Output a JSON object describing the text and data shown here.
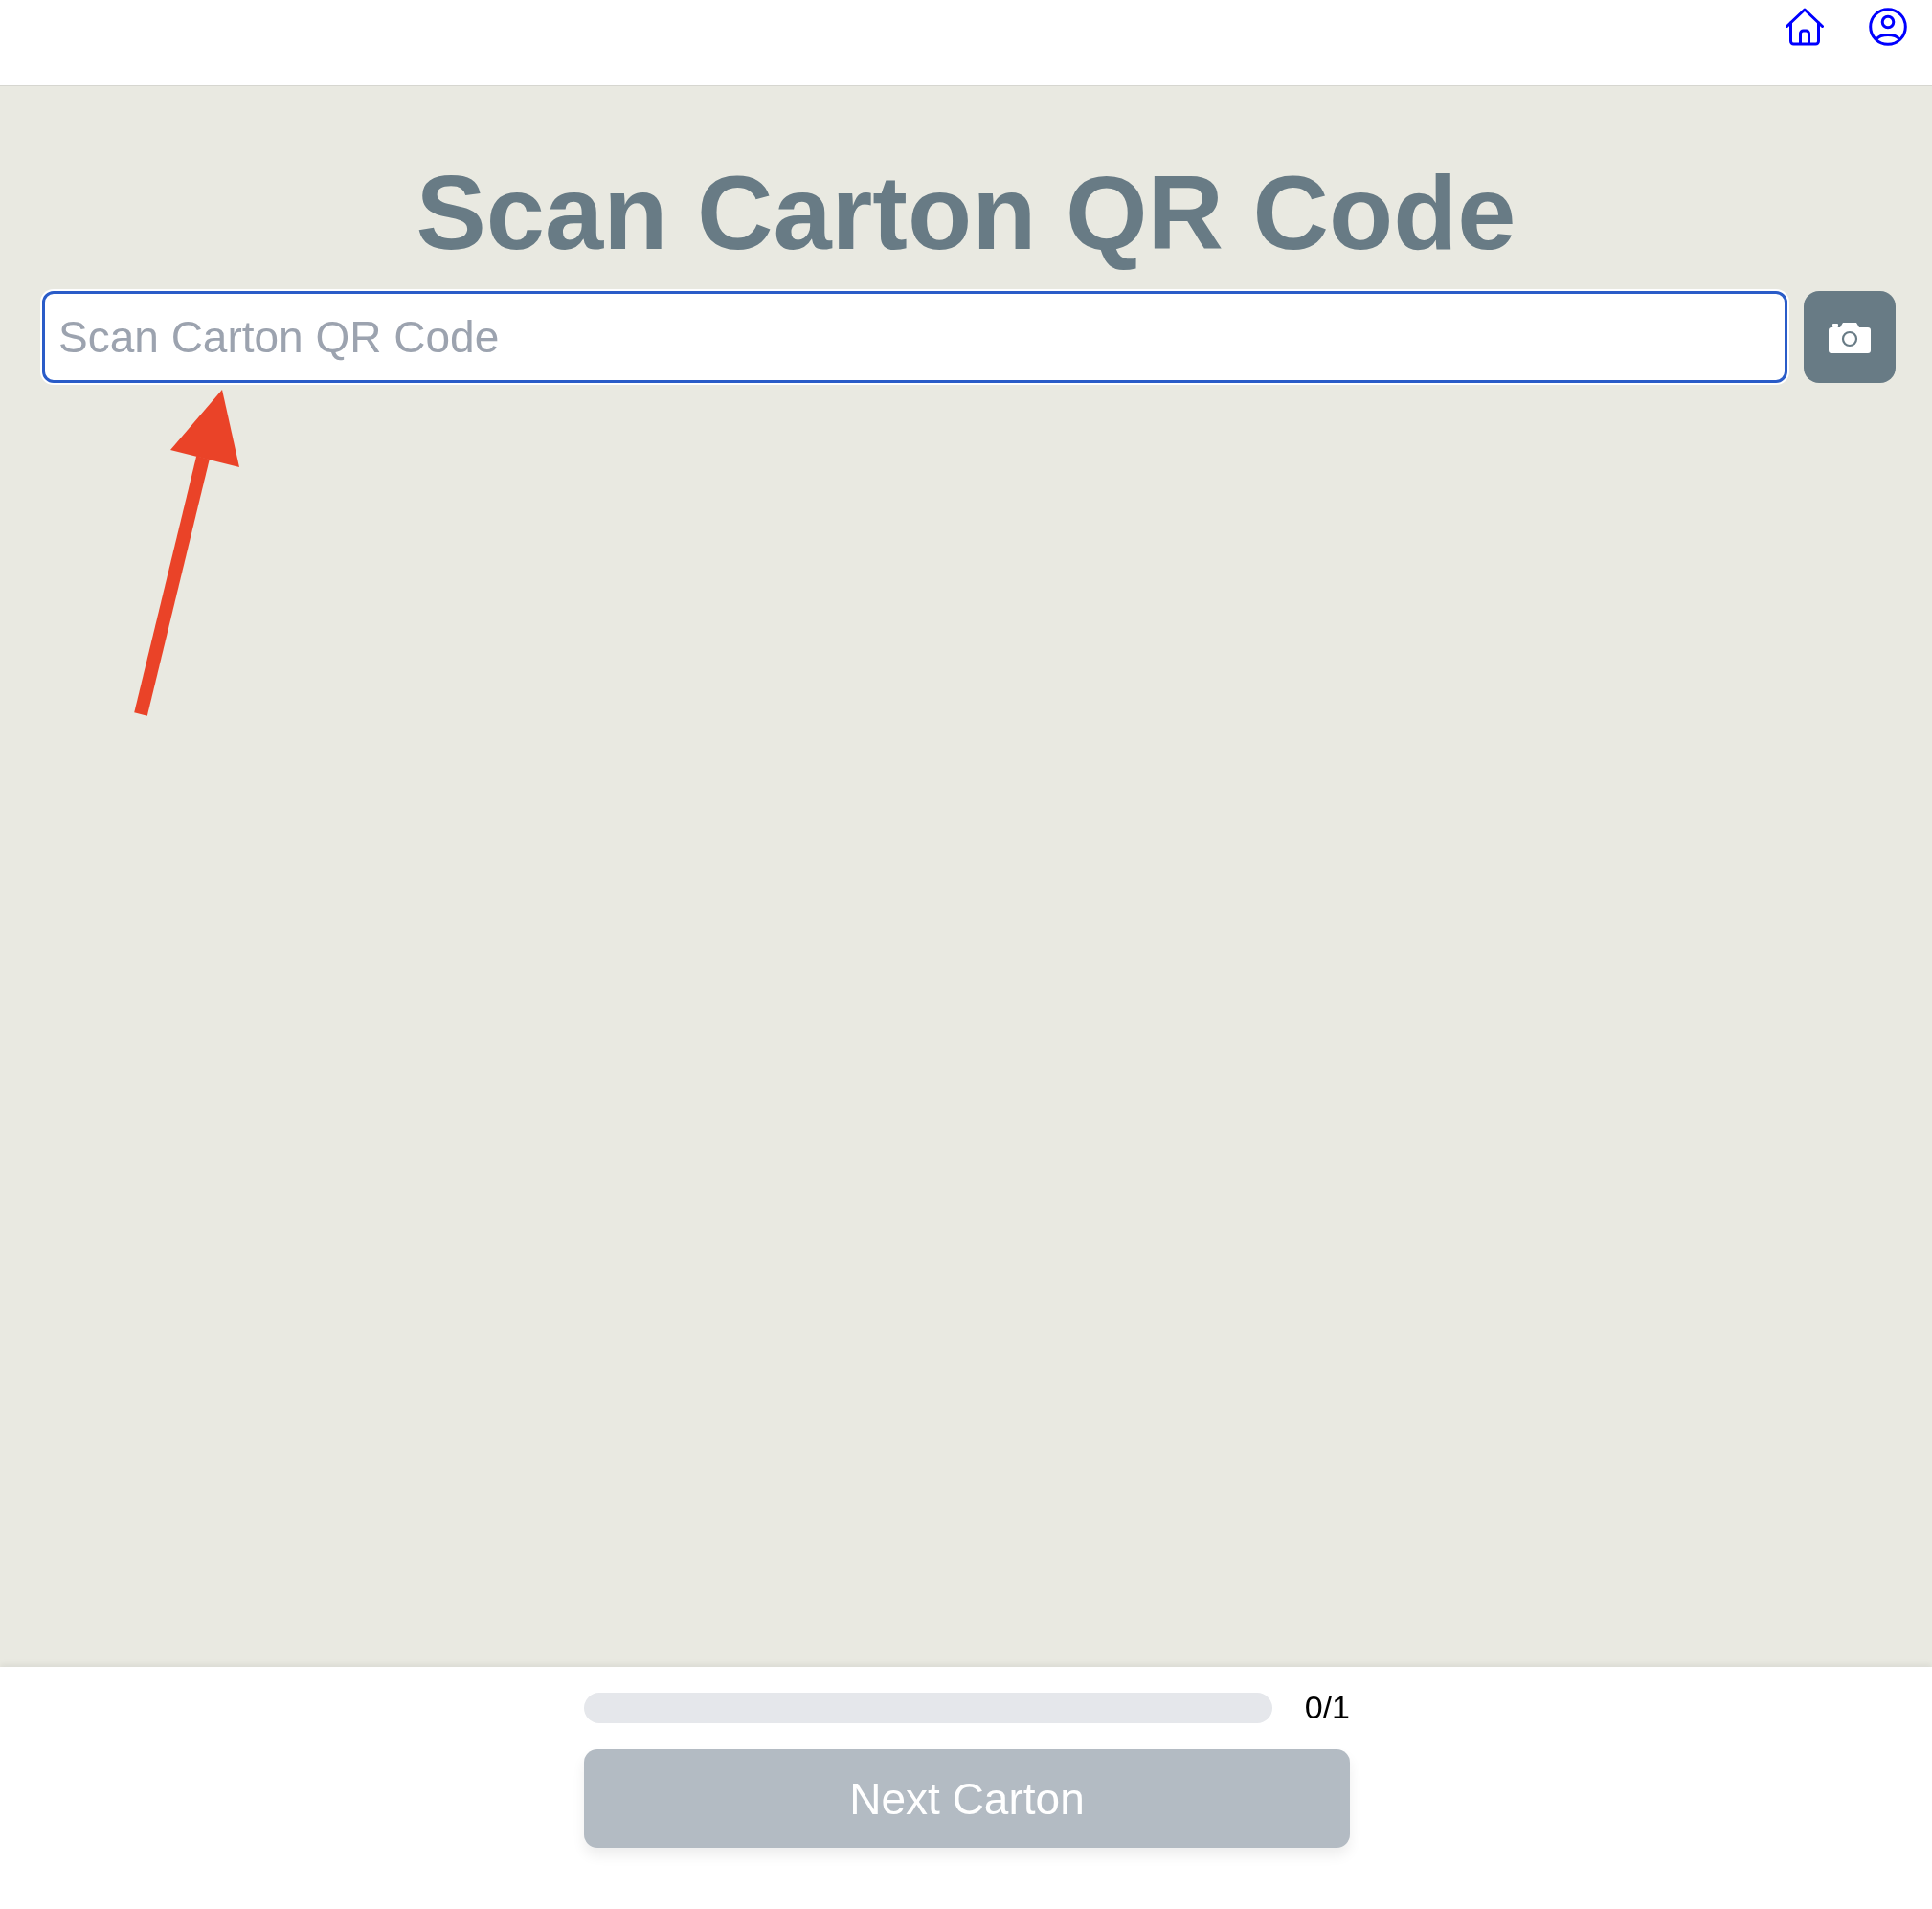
{
  "page": {
    "title": "Scan Carton QR Code"
  },
  "scan_field": {
    "placeholder": "Scan Carton QR Code",
    "focused": true
  },
  "progress": {
    "reading": "0/1"
  },
  "next_button": {
    "label": "Next Carton",
    "disabled": true
  }
}
